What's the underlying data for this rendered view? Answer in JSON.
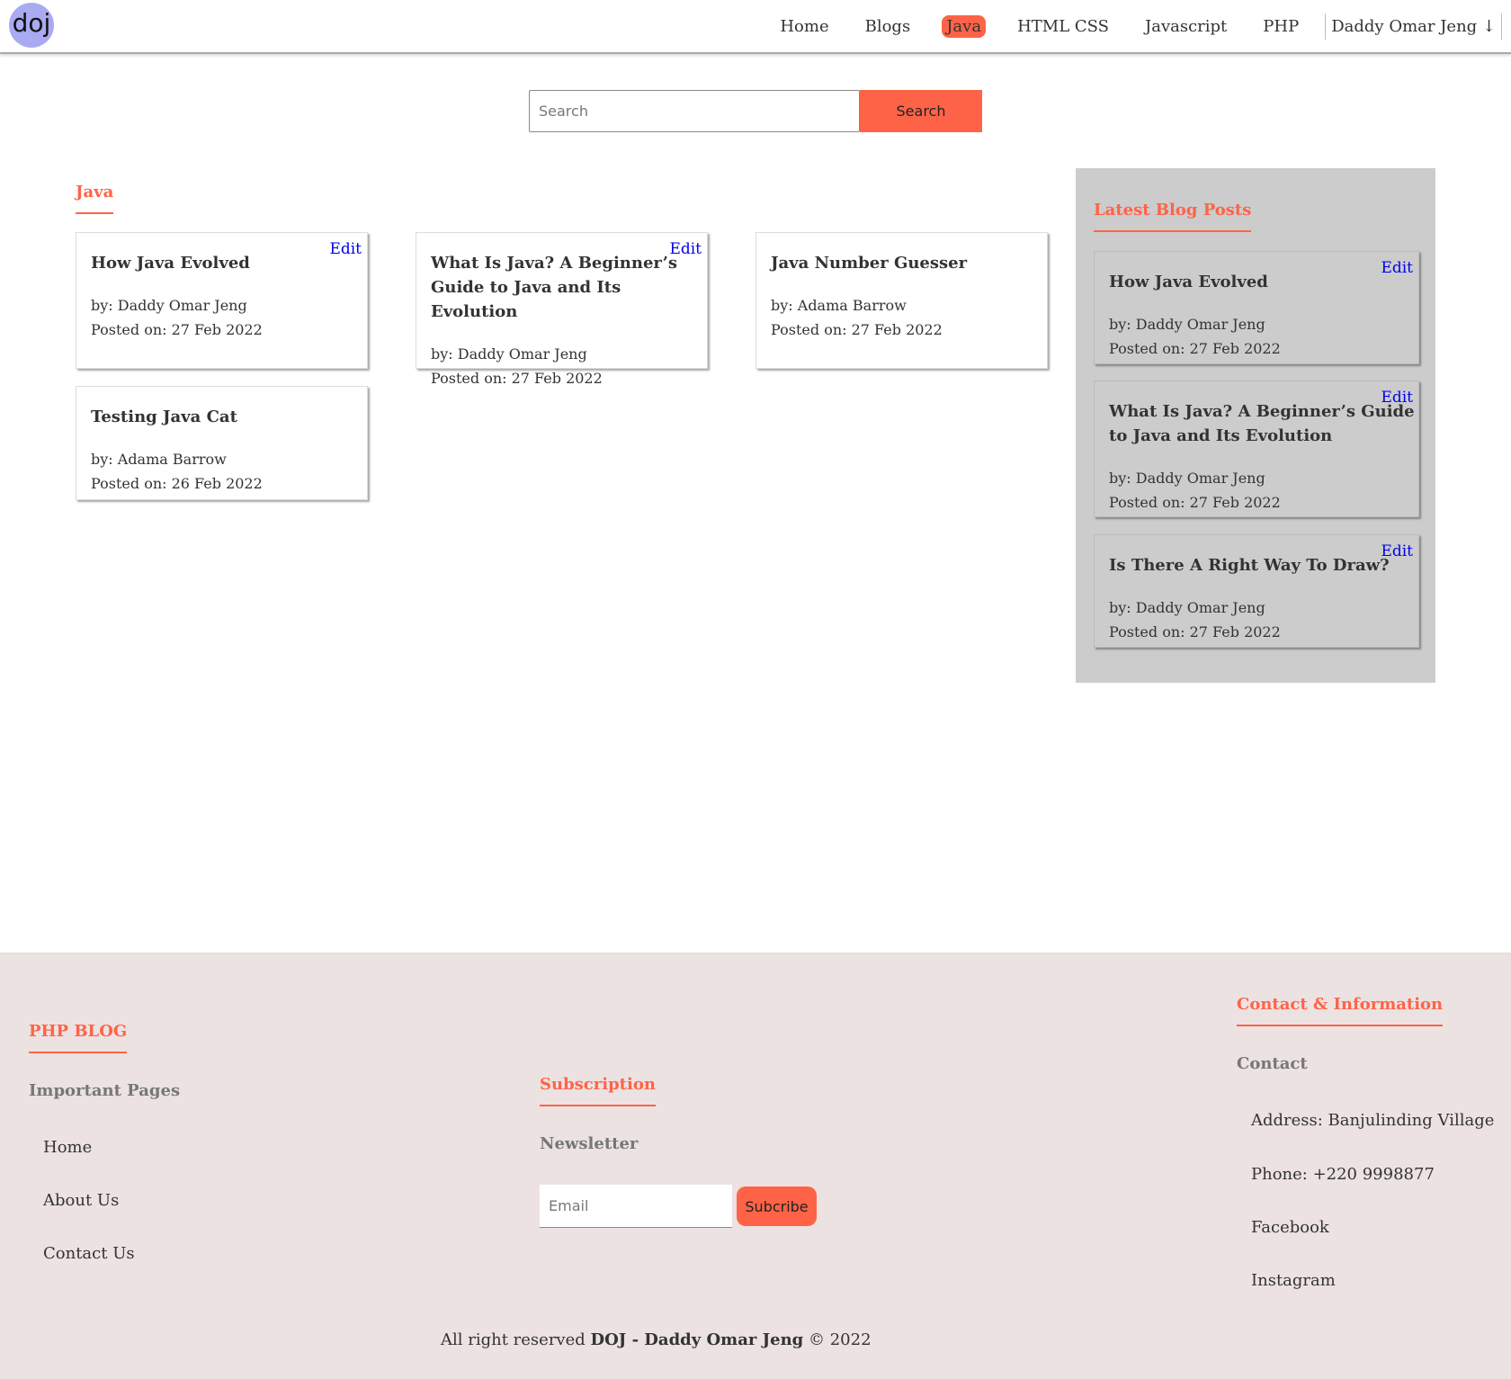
{
  "header": {
    "logo_text": "doj",
    "nav": [
      "Home",
      "Blogs",
      "Java",
      "HTML CSS",
      "Javascript",
      "PHP"
    ],
    "active_nav": "Java",
    "user_menu": "Daddy Omar Jeng ↓"
  },
  "search": {
    "placeholder": "Search",
    "button_label": "Search"
  },
  "category": {
    "title": "Java",
    "posts": [
      {
        "title": "How Java Evolved",
        "author": "by: Daddy Omar Jeng",
        "date": "Posted on: 27 Feb 2022",
        "edit": "Edit"
      },
      {
        "title": "What Is Java? A Beginner’s Guide to Java and Its Evolution",
        "author": "by: Daddy Omar Jeng",
        "date": "Posted on: 27 Feb 2022",
        "edit": "Edit"
      },
      {
        "title": "Java Number Guesser",
        "author": "by: Adama Barrow",
        "date": "Posted on: 27 Feb 2022",
        "edit": ""
      },
      {
        "title": "Testing Java Cat",
        "author": "by: Adama Barrow",
        "date": "Posted on: 26 Feb 2022",
        "edit": ""
      }
    ]
  },
  "sidebar": {
    "title": "Latest Blog Posts",
    "posts": [
      {
        "title": "How Java Evolved",
        "author": "by: Daddy Omar Jeng",
        "date": "Posted on: 27 Feb 2022",
        "edit": "Edit"
      },
      {
        "title": "What Is Java? A Beginner’s Guide to Java and Its Evolution",
        "author": "by: Daddy Omar Jeng",
        "date": "Posted on: 27 Feb 2022",
        "edit": "Edit"
      },
      {
        "title": "Is There A Right Way To Draw?",
        "author": "by: Daddy Omar Jeng",
        "date": "Posted on: 27 Feb 2022",
        "edit": "Edit"
      }
    ]
  },
  "footer": {
    "brand_title": "PHP BLOG",
    "pages_title": "Important Pages",
    "pages": [
      "Home",
      "About Us",
      "Contact Us"
    ],
    "subscription_title": "Subscription",
    "newsletter_title": "Newsletter",
    "email_placeholder": "Email",
    "subscribe_label": "Subcribe",
    "contact_heading": "Contact & Information",
    "contact_title": "Contact",
    "contact_items": [
      "Address: Banjulinding Village",
      "Phone: +220 9998877",
      "Facebook",
      "Instagram"
    ],
    "copyright_prefix": "All right reserved",
    "copyright_name": "DOJ - Daddy Omar Jeng",
    "copyright_suffix": "© 2022"
  },
  "colors": {
    "accent": "#ff6347",
    "logo_bg": "#aaaaf2",
    "sidebar_bg": "#cccccc",
    "footer_bg": "#ece2e2",
    "edit_link": "#0000ee"
  }
}
